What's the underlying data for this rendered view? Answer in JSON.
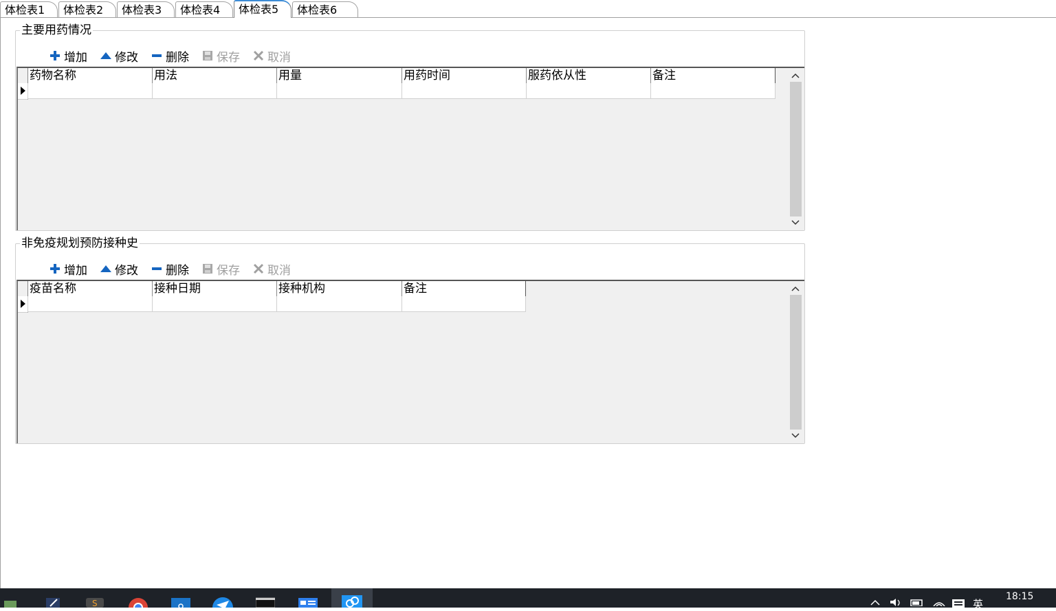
{
  "tabs": [
    "体检表1",
    "体检表2",
    "体检表3",
    "体检表4",
    "体检表5",
    "体检表6"
  ],
  "active_tab_index": 4,
  "toolbar": {
    "add": "增加",
    "edit": "修改",
    "delete": "删除",
    "save": "保存",
    "cancel": "取消"
  },
  "medication": {
    "title": "主要用药情况",
    "columns": [
      "药物名称",
      "用法",
      "用量",
      "用药时间",
      "服药依从性",
      "备注"
    ]
  },
  "vaccination": {
    "title": "非免疫规划预防接种史",
    "columns": [
      "疫苗名称",
      "接种日期",
      "接种机构",
      "备注"
    ]
  },
  "taskbar": {
    "clock": "18:15",
    "ime": "英"
  },
  "colors": {
    "icon_blue": "#1565c0",
    "disabled_gray": "#a0a0a0",
    "taskbar_bg": "#1e2228",
    "active_tab_accent": "#3c8cd6"
  }
}
